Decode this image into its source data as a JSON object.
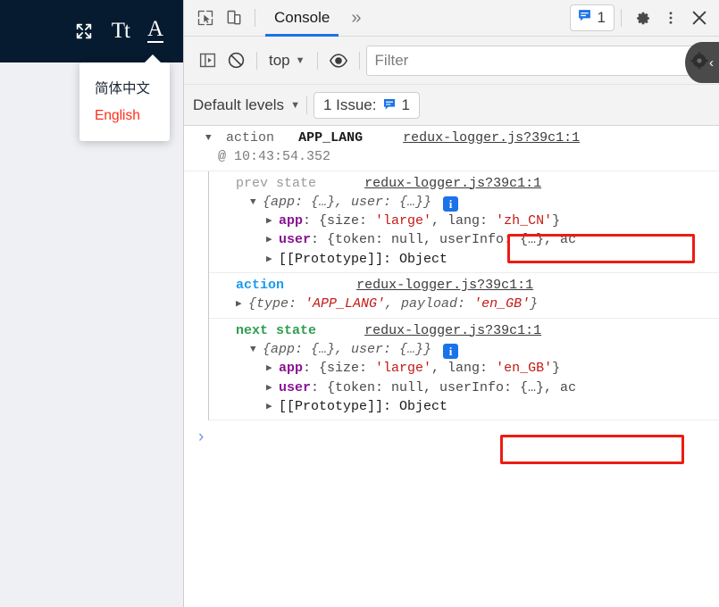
{
  "app_panel": {
    "header_icons": [
      {
        "name": "expand-icon",
        "label": "expand"
      },
      {
        "name": "text-size-icon",
        "label": "Tt"
      },
      {
        "name": "language-icon",
        "label": "A"
      }
    ],
    "language_menu": {
      "items": [
        {
          "label": "简体中文",
          "active": false
        },
        {
          "label": "English",
          "active": true
        }
      ]
    },
    "colors": {
      "header_bg": "#061a30",
      "body_bg": "#eef0f4",
      "active_item": "#ff2d18"
    }
  },
  "devtools": {
    "tabbar": {
      "inspect_icon": "inspect-element-icon",
      "device_icon": "device-toolbar-icon",
      "tabs": [
        {
          "label": "Console",
          "active": true
        }
      ],
      "more_tabs_label": "»",
      "message_count": "1",
      "message_icon": "message-bubble-icon",
      "settings_icon": "gear-icon",
      "overflow_icon": "kebab-menu-icon",
      "close_icon": "close-icon"
    },
    "filterbar": {
      "sidebar_toggle_icon": "console-sidebar-icon",
      "clear_icon": "clear-console-icon",
      "context_label": "top",
      "eye_icon": "live-expression-icon",
      "filter_placeholder": "Filter",
      "filter_value": ""
    },
    "levelsbar": {
      "levels_label": "Default levels",
      "issue_label": "1 Issue:",
      "issue_count": "1",
      "issue_icon": "message-bubble-icon"
    },
    "console": {
      "source_link": "redux-logger.js?39c1:1",
      "group": {
        "title_prefix": "action",
        "title_action": "APP_LANG",
        "timestamp": "@ 10:43:54.352"
      },
      "prev_state": {
        "label": "prev state",
        "preview_open": "{",
        "preview_keys": "app: {…}, user: {…}",
        "preview_close": "}",
        "rows": [
          {
            "key": "app",
            "text_before": ": {size: ",
            "str1": "'large'",
            "text_mid": ", lang: ",
            "str2": "'zh_CN'",
            "text_after": "}",
            "highlight": true
          },
          {
            "key": "user",
            "full": ": {token: null, userInfo: {…}, ac"
          },
          {
            "key": "[[Prototype]]",
            "full": ": Object"
          }
        ]
      },
      "action": {
        "label": "action",
        "preview": "{type: 'APP_LANG', payload: 'en_GB'}",
        "type_str": "'APP_LANG'",
        "payload_str": "'en_GB'"
      },
      "next_state": {
        "label": "next state",
        "preview_open": "{",
        "preview_keys": "app: {…}, user: {…}",
        "preview_close": "}",
        "rows": [
          {
            "key": "app",
            "text_before": ": {size: ",
            "str1": "'large'",
            "text_mid": ", lang: ",
            "str2": "'en_GB'",
            "text_after": "}",
            "highlight": true
          },
          {
            "key": "user",
            "full": ": {token: null, userInfo: {…}, ac"
          },
          {
            "key": "[[Prototype]]",
            "full": ": Object"
          }
        ]
      },
      "prompt_caret": "›",
      "info_badge_label": "i"
    },
    "colors": {
      "tab_accent": "#1a73e8",
      "highlight_box": "#ee1b11",
      "action_label": "#1a9bf0",
      "next_label": "#2e9e4f",
      "string": "#c41a16",
      "prop_key": "#881391"
    }
  }
}
